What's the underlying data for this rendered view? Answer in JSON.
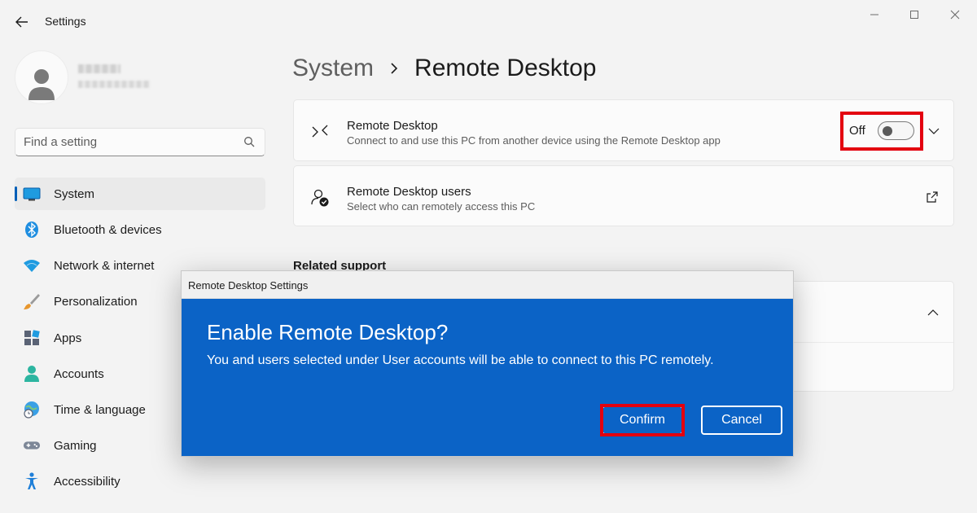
{
  "app": {
    "title": "Settings"
  },
  "sidebar": {
    "search_placeholder": "Find a setting",
    "items": [
      {
        "label": "System",
        "icon": "system-icon",
        "active": true
      },
      {
        "label": "Bluetooth & devices",
        "icon": "bluetooth-icon"
      },
      {
        "label": "Network & internet",
        "icon": "wifi-icon"
      },
      {
        "label": "Personalization",
        "icon": "brush-icon"
      },
      {
        "label": "Apps",
        "icon": "apps-icon"
      },
      {
        "label": "Accounts",
        "icon": "accounts-icon"
      },
      {
        "label": "Time & language",
        "icon": "globe-clock-icon"
      },
      {
        "label": "Gaming",
        "icon": "gamepad-icon"
      },
      {
        "label": "Accessibility",
        "icon": "accessibility-icon"
      }
    ]
  },
  "breadcrumb": {
    "parent": "System",
    "current": "Remote Desktop"
  },
  "remote_desktop": {
    "title": "Remote Desktop",
    "subtitle": "Connect to and use this PC from another device using the Remote Desktop app",
    "toggle_state": "Off"
  },
  "remote_users": {
    "title": "Remote Desktop users",
    "subtitle": "Select who can remotely access this PC"
  },
  "related": {
    "title": "Related support"
  },
  "dialog": {
    "window_title": "Remote Desktop Settings",
    "heading": "Enable Remote Desktop?",
    "message": "You and users selected under User accounts will be able to connect to this PC remotely.",
    "confirm_label": "Confirm",
    "cancel_label": "Cancel"
  },
  "colors": {
    "accent": "#005fb8",
    "dialog_background": "#0b63c6",
    "highlight": "#e3000f",
    "window_background": "#f3f3f3"
  }
}
